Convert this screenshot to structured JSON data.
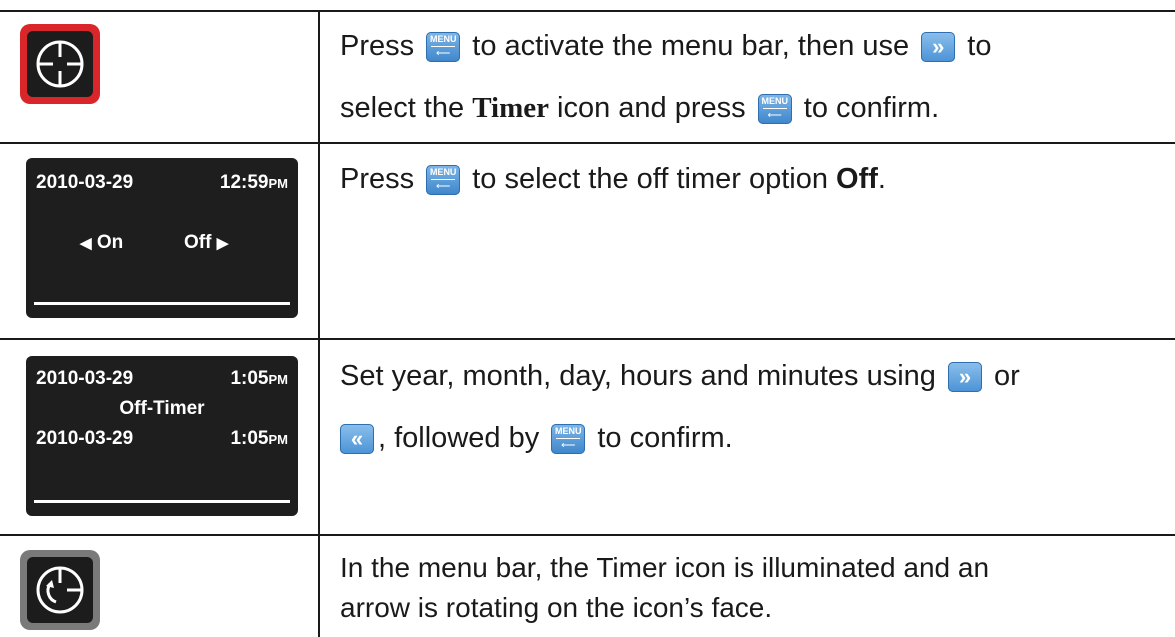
{
  "rows": [
    {
      "icon": "timer-icon-selected",
      "text": {
        "p1": "Press",
        "p2": " to activate the menu bar, then use ",
        "p3": " to",
        "p4": "select the ",
        "bold_word": "Timer",
        "p5": " icon and press ",
        "p6": " to confirm."
      }
    },
    {
      "screen": {
        "date": "2010-03-29",
        "time": "12:59",
        "ampm": "PM",
        "left_option": "On",
        "right_option": "Off"
      },
      "text": {
        "p1": "Press ",
        "p2": " to select the off timer option ",
        "bold_word": "Off",
        "p3": "."
      }
    },
    {
      "screen": {
        "date": "2010-03-29",
        "time": "1:05",
        "ampm": "PM",
        "title": "Off-Timer",
        "date2": "2010-03-29",
        "time2": "1:05",
        "ampm2": "PM"
      },
      "text": {
        "p1": "Set year, month, day, hours and minutes using ",
        "p2": " or",
        "p3": ", followed by ",
        "p4": " to confirm."
      }
    },
    {
      "icon": "timer-icon-illuminated",
      "text": {
        "line1": "In the menu bar, the Timer icon is illuminated and an",
        "line2": "arrow is rotating on the icon’s face."
      }
    }
  ],
  "keys": {
    "menu_label": "MENU",
    "return_glyph": "⟵",
    "right_glyph": "»",
    "left_glyph": "«"
  },
  "colors": {
    "key_blue": "#4a92d6",
    "icon_red_border": "#d9262a",
    "screen_bg": "#1e1e1e"
  }
}
